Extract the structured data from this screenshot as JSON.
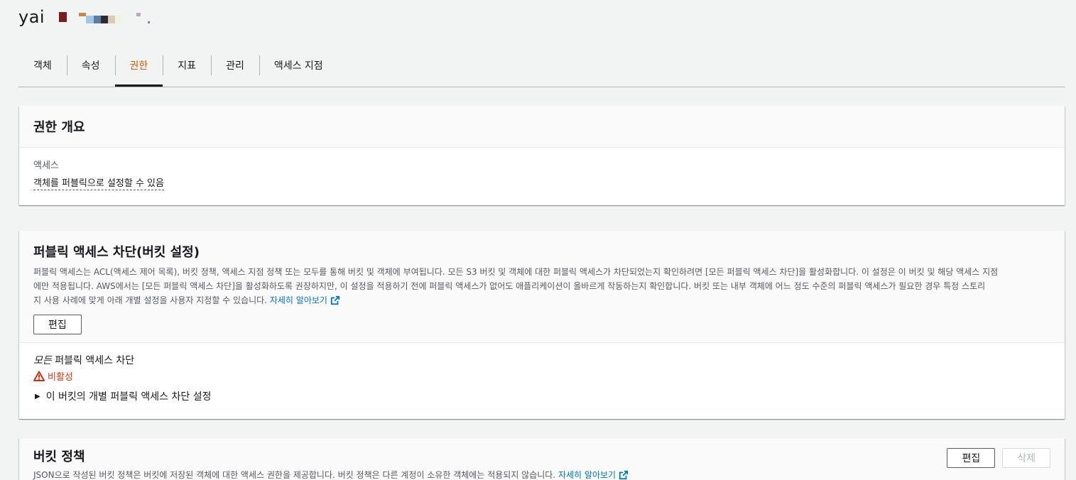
{
  "header": {
    "bucket_title": "yai"
  },
  "tabs": [
    {
      "label": "객체",
      "active": false
    },
    {
      "label": "속성",
      "active": false
    },
    {
      "label": "권한",
      "active": true
    },
    {
      "label": "지표",
      "active": false
    },
    {
      "label": "관리",
      "active": false
    },
    {
      "label": "액세스 지점",
      "active": false
    }
  ],
  "overview": {
    "title": "권한 개요",
    "access_label": "액세스",
    "access_value": "객체를 퍼블릭으로 설정할 수 있음"
  },
  "block_public": {
    "title": "퍼블릭 액세스 차단(버킷 설정)",
    "description_line1": "퍼블릭 액세스는 ACL(액세스 제어 목록), 버킷 정책, 액세스 지점 정책 또는 모두를 통해 버킷 및 객체에 부여됩니다. 모든 S3 버킷 및 객체에 대한 퍼블릭 액세스가 차단되었는지 확인하려면 [모든 퍼블릭 액세스 차단]을 활성화합니다. 이 설정은 이 버킷 및 해당 액세스 지점",
    "description_line2": "에만 적용됩니다. AWS에서는 [모든 퍼블릭 액세스 차단]을 활성화하도록 권장하지만, 이 설정을 적용하기 전에 퍼블릭 액세스가 없어도 애플리케이션이 올바르게 작동하는지 확인합니다. 버킷 또는 내부 객체에 어느 정도 수준의 퍼블릭 액세스가 필요한 경우 특정 스토리",
    "description_line3": "지 사용 사례에 맞게 아래 개별 설정을 사용자 지정할 수 있습니다.",
    "learn_more": "자세히 알아보기",
    "edit_label": "편집",
    "setting_title_em": "모든",
    "setting_title_rest": " 퍼블릭 액세스 차단",
    "status": "비활성",
    "expander_label": "이 버킷의 개별 퍼블릭 액세스 차단 설정",
    "caret": "▶"
  },
  "bucket_policy": {
    "title": "버킷 정책",
    "description": "JSON으로 작성된 버킷 정책은 버킷에 저장된 객체에 대한 액세스 권한을 제공합니다. 버킷 정책은 다른 계정이 소유한 객체에는 적용되지 않습니다. ",
    "learn_more": "자세히 알아보기",
    "edit_label": "편집",
    "delete_label": "삭제"
  },
  "colors": {
    "active_tab": "#d45b07",
    "link": "#0073bb",
    "warning": "#d13212",
    "background": "#f2f3f3"
  },
  "icons": [
    "external-link-icon",
    "warning-triangle-icon",
    "caret-right-icon"
  ]
}
